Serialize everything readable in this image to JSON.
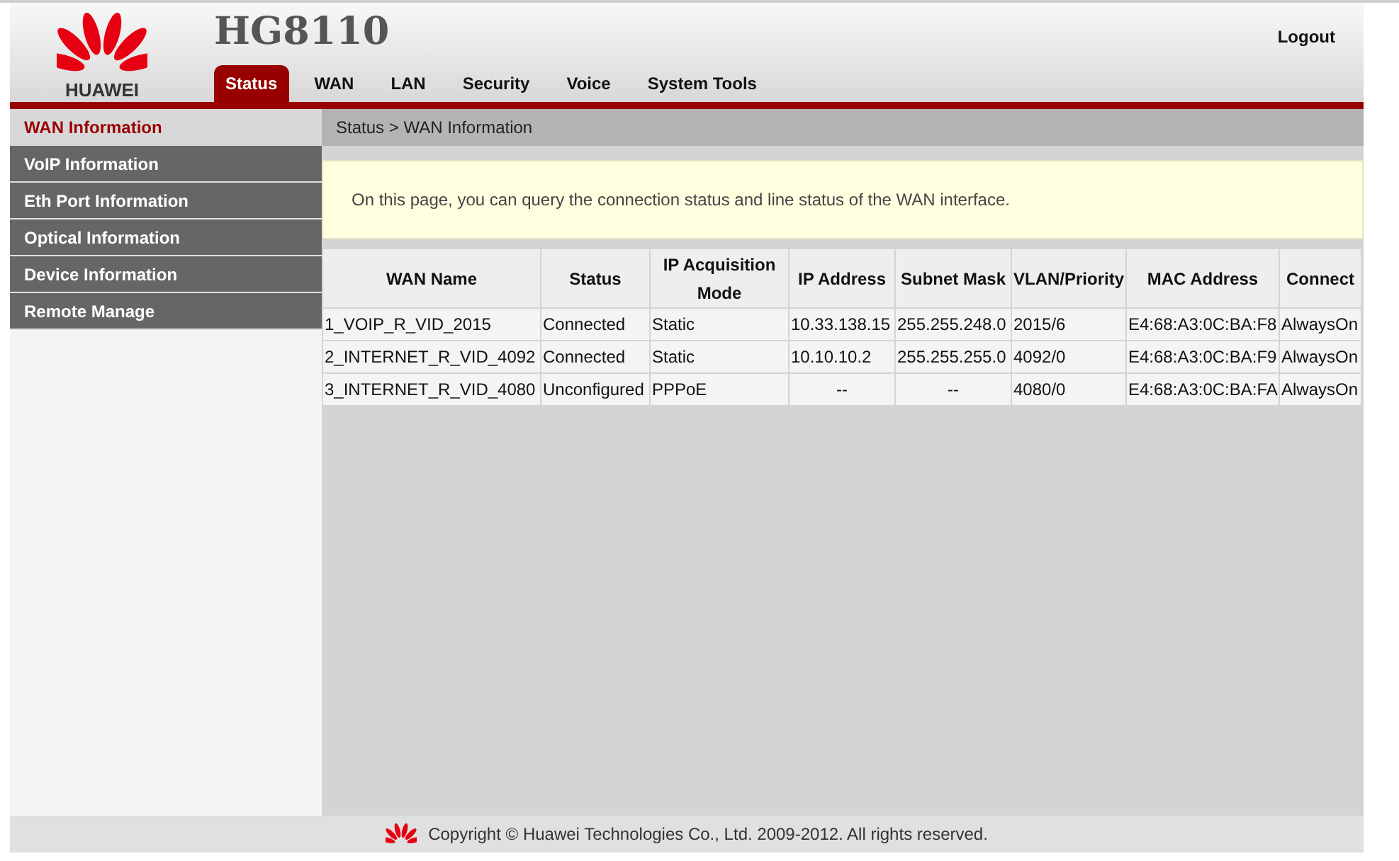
{
  "header": {
    "brand": "HUAWEI",
    "model": "HG8110",
    "logout": "Logout"
  },
  "tabs": [
    {
      "label": "Status",
      "selected": true
    },
    {
      "label": "WAN",
      "selected": false
    },
    {
      "label": "LAN",
      "selected": false
    },
    {
      "label": "Security",
      "selected": false
    },
    {
      "label": "Voice",
      "selected": false
    },
    {
      "label": "System Tools",
      "selected": false
    }
  ],
  "sidebar": {
    "items": [
      {
        "label": "WAN Information",
        "selected": true
      },
      {
        "label": "VoIP Information",
        "selected": false
      },
      {
        "label": "Eth Port Information",
        "selected": false
      },
      {
        "label": "Optical Information",
        "selected": false
      },
      {
        "label": "Device Information",
        "selected": false
      },
      {
        "label": "Remote Manage",
        "selected": false
      }
    ]
  },
  "breadcrumb": "Status > WAN Information",
  "notice": "On this page, you can query the connection status and line status of the WAN interface.",
  "table": {
    "columns": [
      "WAN Name",
      "Status",
      "IP Acquisition Mode",
      "IP Address",
      "Subnet Mask",
      "VLAN/Priority",
      "MAC Address",
      "Connect"
    ],
    "rows": [
      [
        "1_VOIP_R_VID_2015",
        "Connected",
        "Static",
        "10.33.138.15",
        "255.255.248.0",
        "2015/6",
        "E4:68:A3:0C:BA:F8",
        "AlwaysOn"
      ],
      [
        "2_INTERNET_R_VID_4092",
        "Connected",
        "Static",
        "10.10.10.2",
        "255.255.255.0",
        "4092/0",
        "E4:68:A3:0C:BA:F9",
        "AlwaysOn"
      ],
      [
        "3_INTERNET_R_VID_4080",
        "Unconfigured",
        "PPPoE",
        "--",
        "--",
        "4080/0",
        "E4:68:A3:0C:BA:FA",
        "AlwaysOn"
      ]
    ]
  },
  "footer": "Copyright © Huawei Technologies Co., Ltd. 2009-2012. All rights reserved."
}
